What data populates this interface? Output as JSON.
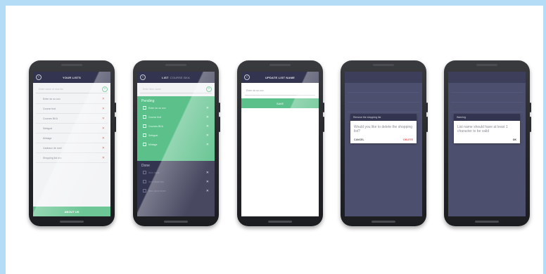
{
  "screen1": {
    "title": "YOUR LISTS",
    "input_placeholder": "Enter name of new list",
    "lists": [
      {
        "label": "Enter do so con"
      },
      {
        "label": "Course fruit"
      },
      {
        "label": "Courses BKA"
      },
      {
        "label": "Sefagrat"
      },
      {
        "label": "Mintage"
      },
      {
        "label": "Cadeaux de noel"
      },
      {
        "label": "Shopping list abc"
      }
    ],
    "footer_button": "ABOUT US",
    "add_icon": "+",
    "delete_icon": "✕",
    "back_icon": "‹"
  },
  "screen2": {
    "title": "LIST",
    "subtitle": "COURSE BKA",
    "input_placeholder": "Enter item name",
    "pending_label": "Pending",
    "pending_items": [
      {
        "label": "Enter do so con"
      },
      {
        "label": "Course fruit"
      },
      {
        "label": "Courses BKA"
      },
      {
        "label": "Sefagrat"
      },
      {
        "label": "Mintage"
      }
    ],
    "done_label": "Done",
    "done_items": [
      {
        "label": "Item done"
      },
      {
        "label": "Item done two"
      },
      {
        "label": "Item done three"
      }
    ]
  },
  "screen3": {
    "title": "UPDATE LIST NAME",
    "input_value": "Enter do so con",
    "save_button": "SAVE"
  },
  "screen4": {
    "dialog_title": "Remove the shopping list",
    "dialog_message": "Would you like to delete the shopping list?",
    "cancel_button": "CANCEL",
    "delete_button": "DELETE"
  },
  "screen5": {
    "dialog_title": "Warning",
    "dialog_message": "List name should have at least 1 character to be valid",
    "ok_button": "OK"
  },
  "colors": {
    "appbar": "#33344f",
    "accent_green": "#5cc08a",
    "delete_red": "#e05a5a",
    "frame_blue": "#b5dcf6"
  }
}
